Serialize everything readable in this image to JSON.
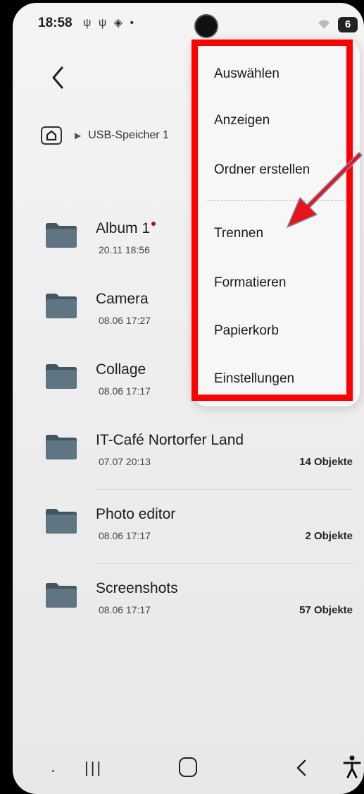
{
  "status_bar": {
    "time": "18:58",
    "left_icons": "ψ ψ ◈ •",
    "battery_badge": "6"
  },
  "header": {
    "back_icon": "chevron-left-icon",
    "breadcrumb_home_icon": "home-folder-icon",
    "breadcrumb_label": "USB-Speicher 1"
  },
  "folders": [
    {
      "name": "Album 1",
      "date": "20.11 18:56",
      "count": "",
      "new_marker": true
    },
    {
      "name": "Camera",
      "date": "08.06 17:27",
      "count": ""
    },
    {
      "name": "Collage",
      "date": "08.06 17:17",
      "count": ""
    },
    {
      "name": "IT-Café Nortorfer Land",
      "date": "07.07 20:13",
      "count": "14 Objekte"
    },
    {
      "name": "Photo editor",
      "date": "08.06 17:17",
      "count": "2 Objekte"
    },
    {
      "name": "Screenshots",
      "date": "08.06 17:17",
      "count": "57 Objekte"
    }
  ],
  "menu": {
    "items": [
      {
        "label": "Auswählen"
      },
      {
        "label": "Anzeigen"
      },
      {
        "label": "Ordner erstellen"
      },
      {
        "label": "Trennen"
      },
      {
        "label": "Formatieren"
      },
      {
        "label": "Papierkorb"
      },
      {
        "label": "Einstellungen"
      }
    ]
  },
  "annotation": {
    "highlight_color": "#ff0000",
    "arrow_color": "#e8141c",
    "arrow_target": "Trennen"
  },
  "colors": {
    "background": "#efefef",
    "folder_icon": "#5f7581",
    "folder_icon_dark": "#44565f"
  }
}
